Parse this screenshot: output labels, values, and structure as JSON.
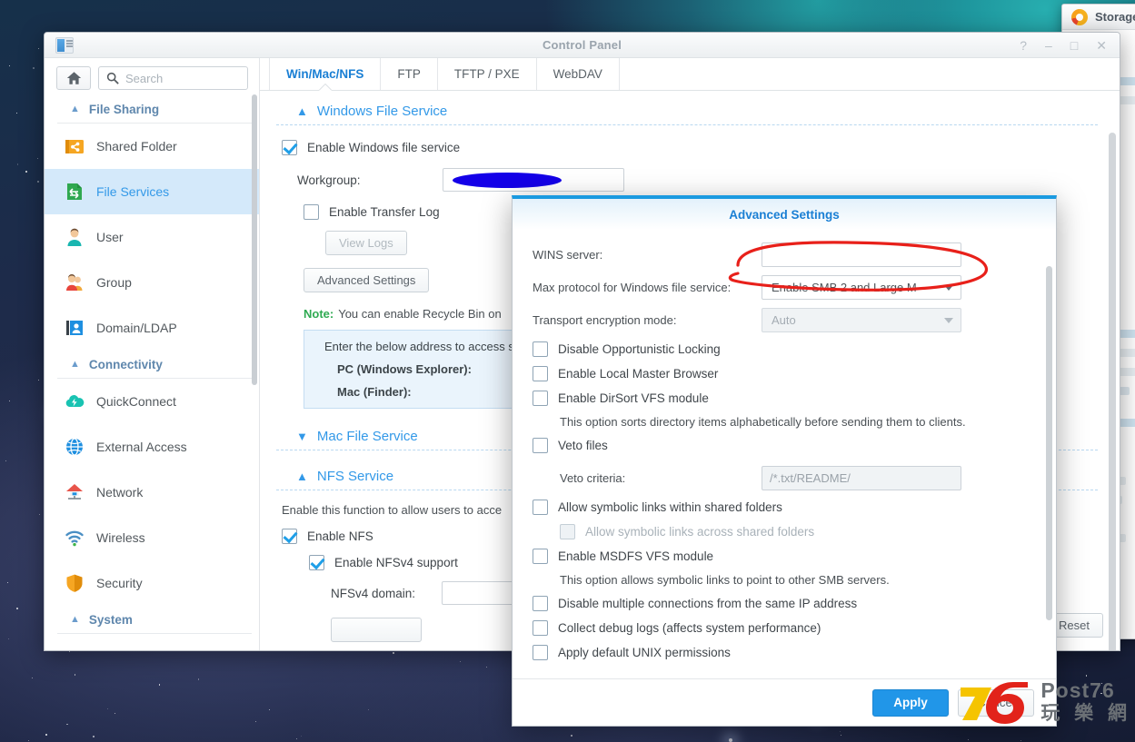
{
  "desktop": {
    "wallpaper": "dark-blue-starfield"
  },
  "background_window": {
    "title": "Storage",
    "icon": "storage-donut-icon"
  },
  "control_panel": {
    "title": "Control Panel",
    "app_icon": "control-panel-icon",
    "window_buttons": {
      "help": "?",
      "minimize": "–",
      "maximize": "□",
      "close": "✕"
    },
    "search": {
      "placeholder": "Search",
      "value": ""
    },
    "home_button": "home-icon",
    "sidebar": {
      "groups": [
        {
          "label": "File Sharing",
          "items": [
            {
              "label": "Shared Folder",
              "icon": "shared-folder-icon",
              "active": false
            },
            {
              "label": "File Services",
              "icon": "file-services-icon",
              "active": true
            },
            {
              "label": "User",
              "icon": "user-icon",
              "active": false
            },
            {
              "label": "Group",
              "icon": "group-icon",
              "active": false
            },
            {
              "label": "Domain/LDAP",
              "icon": "domain-ldap-icon",
              "active": false
            }
          ]
        },
        {
          "label": "Connectivity",
          "items": [
            {
              "label": "QuickConnect",
              "icon": "quickconnect-icon",
              "active": false
            },
            {
              "label": "External Access",
              "icon": "external-access-icon",
              "active": false
            },
            {
              "label": "Network",
              "icon": "network-icon",
              "active": false
            },
            {
              "label": "Wireless",
              "icon": "wireless-icon",
              "active": false
            },
            {
              "label": "Security",
              "icon": "security-shield-icon",
              "active": false
            }
          ]
        },
        {
          "label": "System",
          "items": []
        }
      ]
    },
    "tabs": [
      {
        "label": "Win/Mac/NFS",
        "active": true
      },
      {
        "label": "FTP",
        "active": false
      },
      {
        "label": "TFTP / PXE",
        "active": false
      },
      {
        "label": "WebDAV",
        "active": false
      }
    ],
    "windows_file_service": {
      "section_title": "Windows File Service",
      "enable_label": "Enable Windows file service",
      "enable_checked": true,
      "workgroup_label": "Workgroup:",
      "workgroup_value": "",
      "workgroup_redacted": true,
      "transfer_log_label": "Enable Transfer Log",
      "transfer_log_checked": false,
      "view_logs_button": "View Logs",
      "advanced_settings_button": "Advanced Settings",
      "note_prefix": "Note:",
      "note_text": "You can enable Recycle Bin on",
      "info_intro": "Enter the below address to access s",
      "info_pc_label": "PC (Windows Explorer):",
      "info_mac_label": "Mac (Finder):"
    },
    "mac_file_service": {
      "section_title": "Mac File Service",
      "expanded": false
    },
    "nfs_service": {
      "section_title": "NFS Service",
      "expanded": true,
      "description": "Enable this function to allow users to acce",
      "enable_nfs_label": "Enable NFS",
      "enable_nfs_checked": true,
      "enable_nfsv4_label": "Enable NFSv4 support",
      "enable_nfsv4_checked": true,
      "nfsv4_domain_label": "NFSv4 domain:",
      "nfsv4_domain_value": ""
    },
    "reset_button": "Reset"
  },
  "advanced_settings_dialog": {
    "title": "Advanced Settings",
    "fields": {
      "wins_server_label": "WINS server:",
      "wins_server_value": "",
      "max_protocol_label": "Max protocol for Windows file service:",
      "max_protocol_value": "Enable SMB 2 and Large M",
      "transport_encryption_label": "Transport encryption mode:",
      "transport_encryption_value": "Auto",
      "transport_encryption_disabled": true,
      "veto_criteria_label": "Veto criteria:",
      "veto_criteria_placeholder": "/*.txt/README/"
    },
    "checkboxes": [
      {
        "label": "Disable Opportunistic Locking",
        "checked": false,
        "disabled": false
      },
      {
        "label": "Enable Local Master Browser",
        "checked": false,
        "disabled": false
      },
      {
        "label": "Enable DirSort VFS module",
        "checked": false,
        "disabled": false
      },
      {
        "label": "Veto files",
        "checked": false,
        "disabled": false
      },
      {
        "label": "Allow symbolic links within shared folders",
        "checked": false,
        "disabled": false
      },
      {
        "label": "Allow symbolic links across shared folders",
        "checked": false,
        "disabled": true
      },
      {
        "label": "Enable MSDFS VFS module",
        "checked": false,
        "disabled": false
      },
      {
        "label": "Disable multiple connections from the same IP address",
        "checked": false,
        "disabled": false
      },
      {
        "label": "Collect debug logs (affects system performance)",
        "checked": false,
        "disabled": false
      },
      {
        "label": "Apply default UNIX permissions",
        "checked": false,
        "disabled": false
      }
    ],
    "descriptions": {
      "dirsort": "This option sorts directory items alphabetically before sending them to clients.",
      "msdfs": "This option allows symbolic links to point to other SMB servers."
    },
    "buttons": {
      "apply": "Apply",
      "cancel": "Cancel"
    }
  },
  "annotation": {
    "type": "red-ellipse-highlight",
    "color": "#e8201a",
    "target": "max-protocol-dropdown"
  },
  "watermark": {
    "line1": "Post76",
    "line2": "玩 樂 網",
    "logo": "76-logo"
  },
  "colors": {
    "accent_blue": "#3399e8",
    "link_blue": "#1a7fd4",
    "sidebar_active": "#d4e9fa",
    "green": "#2faa52",
    "annotation_red": "#e8201a"
  }
}
